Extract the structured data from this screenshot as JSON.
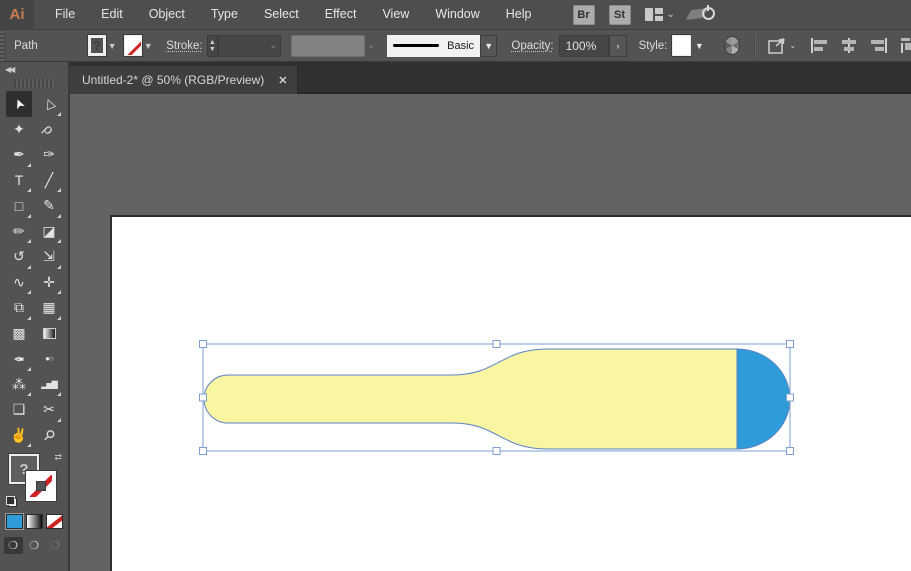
{
  "colors": {
    "logo_orange": "#CA7C4F",
    "accent_blue": "#2D9CD9",
    "shape_fill": "#F8F5A3",
    "shape_cap_fill": "#2D9CD9",
    "shape_outline": "#5E83C5",
    "selection_blue": "#7E9FD0"
  },
  "menubar": {
    "logo": "Ai",
    "items": [
      "File",
      "Edit",
      "Object",
      "Type",
      "Select",
      "Effect",
      "View",
      "Window",
      "Help"
    ],
    "bridge_label": "Br",
    "stock_label": "St"
  },
  "controlbar": {
    "selection_type": "Path",
    "fill_placeholder": "?",
    "stroke_label": "Stroke:",
    "brush_style": "Basic",
    "opacity_label": "Opacity:",
    "opacity_value": "100%",
    "opacity_more": "›",
    "style_label": "Style:"
  },
  "tab": {
    "title": "Untitled-2* @ 50% (RGB/Preview)",
    "close_glyph": "✕"
  },
  "toolbar": {
    "collapse_glyph": "◀◀",
    "fill_placeholder": "?",
    "tools": [
      {
        "name": "selection",
        "glyph": "➤",
        "cls": "rotArr",
        "active": true,
        "flyout": false
      },
      {
        "name": "direct-selection",
        "glyph": "▷",
        "cls": "rotArr",
        "flyout": true
      },
      {
        "name": "magic-wand",
        "glyph": "✦",
        "flyout": false
      },
      {
        "name": "lasso",
        "glyph": "ρ",
        "cls": "rot45",
        "flyout": false
      },
      {
        "name": "pen",
        "glyph": "✒",
        "flyout": true
      },
      {
        "name": "curvature",
        "glyph": "✑",
        "flyout": false
      },
      {
        "name": "type",
        "glyph": "T",
        "flyout": true
      },
      {
        "name": "line-segment",
        "glyph": "╱",
        "flyout": true
      },
      {
        "name": "rectangle",
        "glyph": "□",
        "flyout": true
      },
      {
        "name": "paintbrush",
        "glyph": "✎",
        "flyout": true
      },
      {
        "name": "shaper",
        "glyph": "✏",
        "flyout": true
      },
      {
        "name": "eraser",
        "glyph": "◪",
        "flyout": true
      },
      {
        "name": "rotate",
        "glyph": "↺",
        "flyout": true
      },
      {
        "name": "scale",
        "glyph": "⇲",
        "flyout": true
      },
      {
        "name": "width",
        "glyph": "∿",
        "flyout": true
      },
      {
        "name": "puppet-warp",
        "glyph": "✛",
        "flyout": true
      },
      {
        "name": "shape-builder",
        "glyph": "⧉",
        "flyout": true
      },
      {
        "name": "perspective-grid",
        "glyph": "▦",
        "flyout": true
      },
      {
        "name": "mesh",
        "glyph": "▩",
        "flyout": false
      },
      {
        "name": "gradient",
        "glyph": "",
        "cls": "grad-box",
        "flyout": false
      },
      {
        "name": "eyedropper",
        "glyph": "✒",
        "cls": "flipud",
        "flyout": true
      },
      {
        "name": "blend",
        "glyph": "●○",
        "cls": "tiny",
        "flyout": false
      },
      {
        "name": "symbol-sprayer",
        "glyph": "⁂",
        "flyout": true
      },
      {
        "name": "column-graph",
        "glyph": "▂▅▇",
        "cls": "tiny",
        "flyout": true
      },
      {
        "name": "artboard",
        "glyph": "❏",
        "flyout": false
      },
      {
        "name": "slice",
        "glyph": "✂",
        "flyout": true
      },
      {
        "name": "hand",
        "glyph": "✌",
        "flyout": true
      },
      {
        "name": "zoom",
        "glyph": "⚲",
        "cls": "rot45",
        "flyout": false
      }
    ],
    "draw_modes": [
      "draw-normal",
      "draw-behind",
      "draw-inside"
    ],
    "draw_mode_glyph": "❍"
  }
}
